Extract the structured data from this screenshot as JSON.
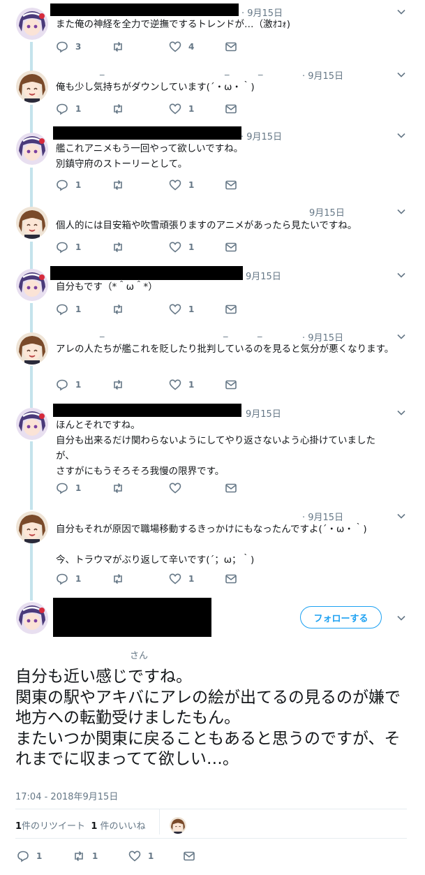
{
  "tweets": [
    {
      "avatar": "purple-hair-avatar",
      "date": "· 9月15日",
      "text": "また俺の神経を全力で逆撫でするトレンドが…（激ｵｺｫ)",
      "reply": "3",
      "retweet": "",
      "like": "4"
    },
    {
      "avatar": "brown-hair-avatar",
      "date": "· 9月15日",
      "text": "俺も少し気持ちがダウンしています(´・ω・｀)",
      "reply": "1",
      "retweet": "",
      "like": "1"
    },
    {
      "avatar": "purple-hair-avatar",
      "date": "· 9月15日",
      "text": "艦これアニメもう一回やって欲しいですね。\n別鎮守府のストーリーとして。",
      "reply": "1",
      "retweet": "",
      "like": "1"
    },
    {
      "avatar": "brown-hair-avatar",
      "date": "9月15日",
      "text": "個人的には目安箱や吹雪頑張りますのアニメがあったら見たいですね。",
      "reply": "1",
      "retweet": "",
      "like": "1"
    },
    {
      "avatar": "purple-hair-avatar",
      "date": "9月15日",
      "text": "自分もです（*＾ω＾*）",
      "reply": "1",
      "retweet": "",
      "like": "1"
    },
    {
      "avatar": "brown-hair-avatar",
      "date": "· 9月15日",
      "text": "アレの人たちが艦これを貶したり批判しているのを見ると気分が悪くなります。",
      "reply": "1",
      "retweet": "",
      "like": "1"
    },
    {
      "avatar": "purple-hair-avatar",
      "date": "9月15日",
      "text": "ほんとそれですね。\n自分も出来るだけ関わらないようにしてやり返さないよう心掛けていましたが、\nさすがにもうそろそろ我慢の限界です。",
      "reply": "1",
      "retweet": "",
      "like": ""
    },
    {
      "avatar": "brown-hair-avatar",
      "date": "· 9月15日",
      "text": "自分もそれが原因で職場移動するきっかけにもなったんですよ(´・ω・｀)\n\n今、トラウマがぶり返して辛いです(´；ω；｀)",
      "reply": "1",
      "retweet": "",
      "like": "1"
    }
  ],
  "main": {
    "follow_label": "フォローする",
    "san": "さん",
    "text": "自分も近い感じですね。\n関東の駅やアキバにアレの絵が出てるの見るのが嫌で地方への転勤受けましたもん。\nまたいつか関東に戻ることもあると思うのですが、それまでに収まってて欲しい…。",
    "timestamp": "17:04 - 2018年9月15日",
    "retweet_count": "1",
    "retweet_label": "件のリツイート",
    "like_count": "1",
    "like_label": " 件のいいね",
    "reply": "1",
    "retweet": "1",
    "like": "1"
  },
  "colors": {
    "accent": "#1da1f2",
    "muted": "#657786",
    "thread": "#c4e3ec",
    "text": "#14171a"
  }
}
